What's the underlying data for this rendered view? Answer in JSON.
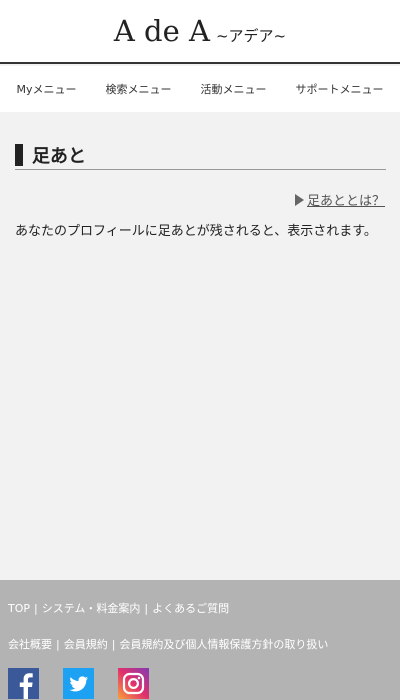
{
  "header": {
    "logo_main": "A de A",
    "logo_sub": "~アデア~"
  },
  "nav": {
    "items": [
      {
        "label": "Myメニュー"
      },
      {
        "label": "検索メニュー"
      },
      {
        "label": "活動メニュー"
      },
      {
        "label": "サポートメニュー"
      }
    ]
  },
  "main": {
    "title": "足あと",
    "help_link": "足あととは？",
    "description": "あなたのプロフィールに足あとが残されると、表示されます。"
  },
  "footer": {
    "row1": [
      "TOP",
      "システム・料金案内",
      "よくあるご質問"
    ],
    "row2": [
      "会社概要",
      "会員規約",
      "会員規約及び個人情報保護方針の取り扱い"
    ],
    "separator": "|",
    "social": [
      {
        "icon": "facebook-icon",
        "color": "#3b5998"
      },
      {
        "icon": "twitter-icon",
        "color": "#1da1f2"
      },
      {
        "icon": "instagram-icon",
        "color": "#e1306c"
      }
    ]
  }
}
